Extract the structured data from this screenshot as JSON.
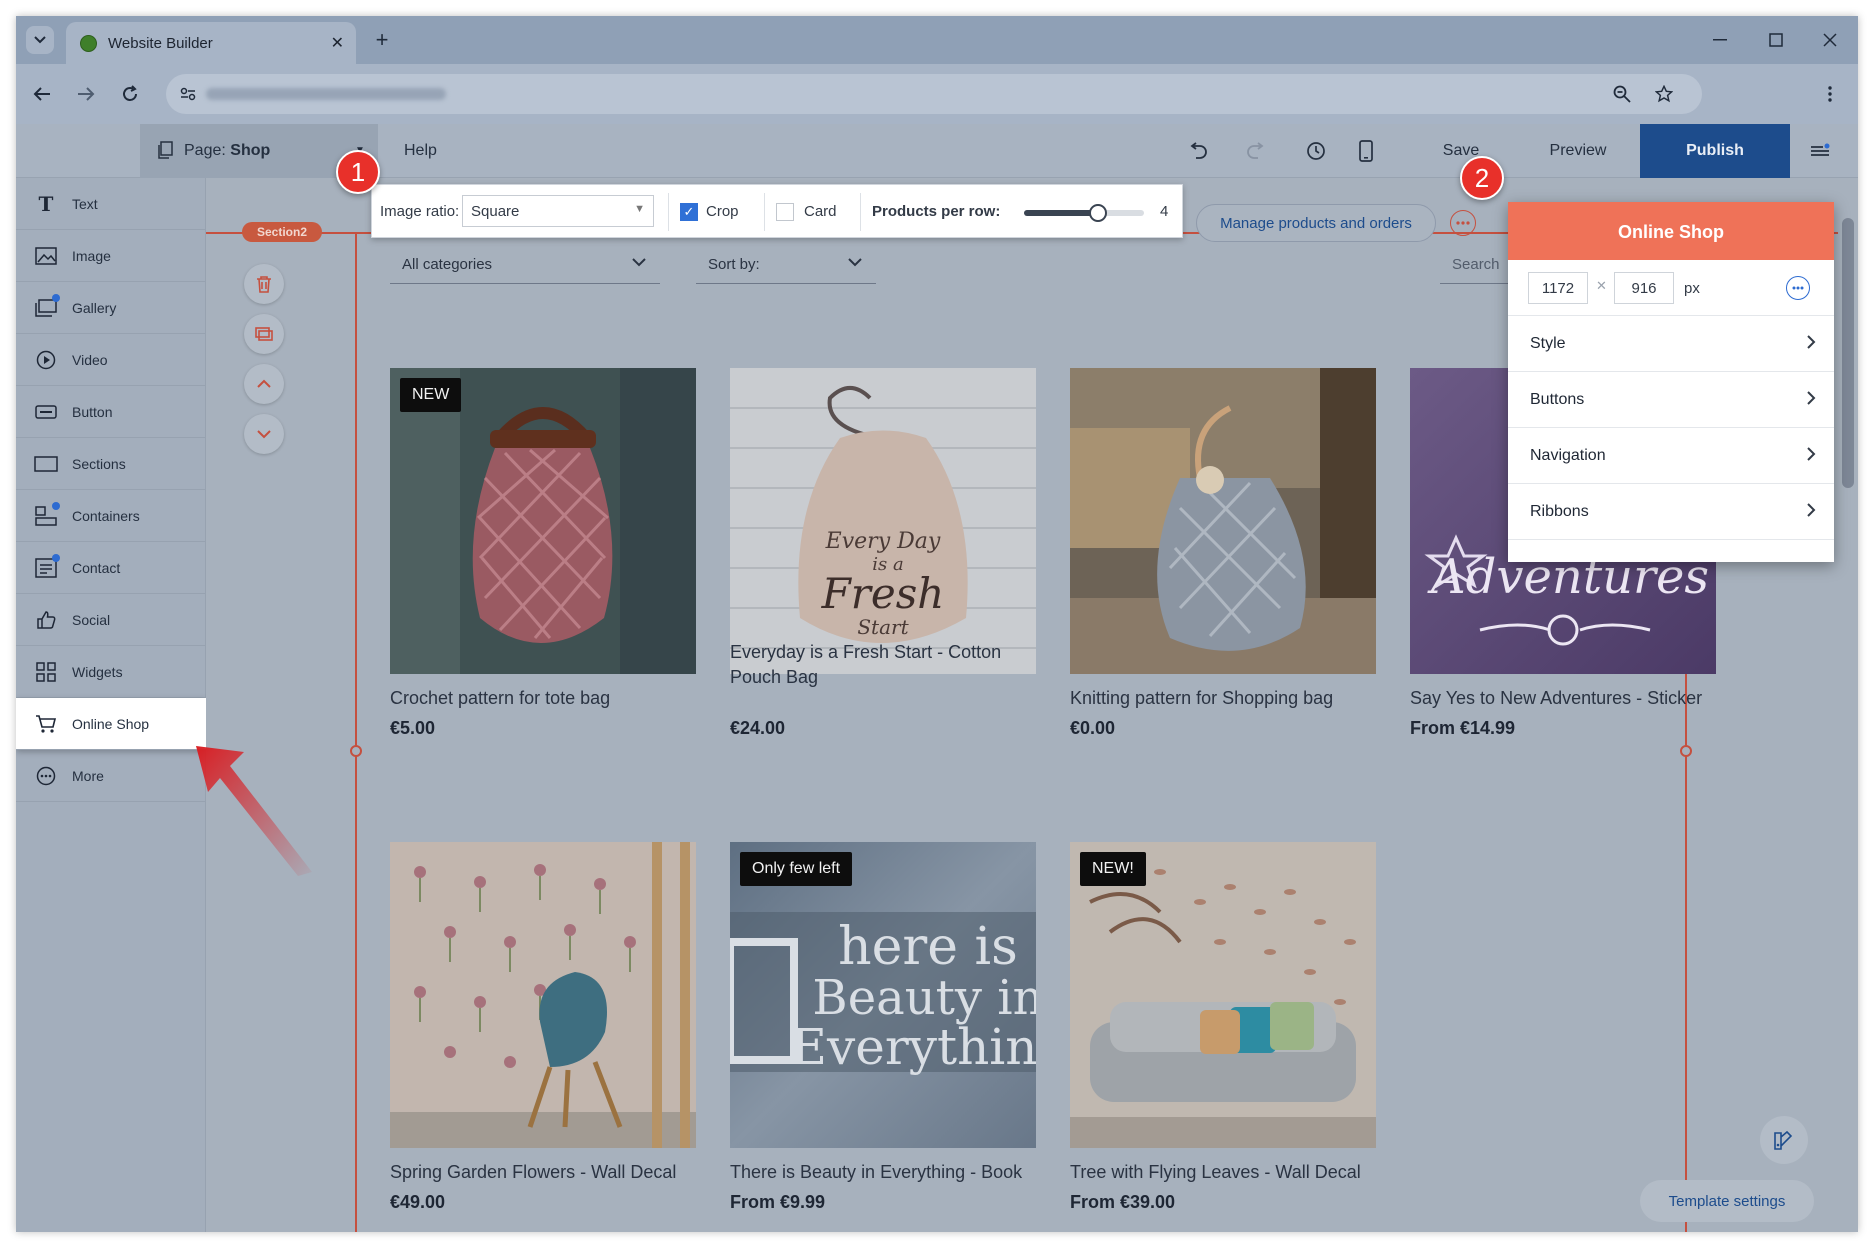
{
  "browser": {
    "tab_title": "Website Builder",
    "new_tab_symbol": "+"
  },
  "topbar": {
    "page_prefix": "Page:",
    "page_name": "Shop",
    "help": "Help",
    "save": "Save",
    "preview": "Preview",
    "publish": "Publish"
  },
  "sidebar": {
    "items": [
      {
        "label": "Text"
      },
      {
        "label": "Image"
      },
      {
        "label": "Gallery"
      },
      {
        "label": "Video"
      },
      {
        "label": "Button"
      },
      {
        "label": "Sections"
      },
      {
        "label": "Containers"
      },
      {
        "label": "Contact"
      },
      {
        "label": "Social"
      },
      {
        "label": "Widgets"
      },
      {
        "label": "Online Shop"
      },
      {
        "label": "More"
      }
    ],
    "active": "Online Shop"
  },
  "canvas": {
    "section_tag": "Section2"
  },
  "image_toolbar": {
    "ratio_label": "Image ratio:",
    "ratio_value": "Square",
    "crop_label": "Crop",
    "crop_checked": true,
    "card_label": "Card",
    "card_checked": false,
    "per_row_label": "Products per row:",
    "per_row_value": "4",
    "per_row_fraction": 0.62
  },
  "manage_button": "Manage products and orders",
  "shop_filters": {
    "categories": "All categories",
    "sort": "Sort by:",
    "search_placeholder": "Search"
  },
  "callouts": {
    "one": "1",
    "two": "2"
  },
  "products": [
    {
      "name": "Crochet pattern for tote bag",
      "price": "€5.00",
      "ribbon": "NEW"
    },
    {
      "name": "Everyday is a Fresh Start - Cotton Pouch Bag",
      "price": "€24.00",
      "ribbon": ""
    },
    {
      "name": "Knitting pattern for Shopping bag",
      "price": "€0.00",
      "ribbon": ""
    },
    {
      "name": "Say Yes to New Adventures - Sticker",
      "price": "From €14.99",
      "ribbon": ""
    },
    {
      "name": "Spring Garden Flowers - Wall Decal",
      "price": "€49.00",
      "ribbon": ""
    },
    {
      "name": "There is Beauty in Everything - Book",
      "price": "From €9.99",
      "ribbon": "Only few left"
    },
    {
      "name": "Tree with Flying Leaves - Wall Decal",
      "price": "From €39.00",
      "ribbon": "NEW!"
    }
  ],
  "product_art": {
    "pouch": [
      "Every Day",
      "is a",
      "Fresh",
      "Start"
    ],
    "sticker": "Adventures",
    "book": [
      "here is",
      "Beauty in",
      "Everything"
    ]
  },
  "shop_panel": {
    "title": "Online Shop",
    "width": "1172",
    "height": "916",
    "unit": "px",
    "rows": [
      "Style",
      "Buttons",
      "Navigation",
      "Ribbons"
    ]
  },
  "template_settings": "Template settings",
  "colors": {
    "accent": "#ef7258",
    "publish": "#1d4c8c",
    "callout": "#e8302a"
  }
}
